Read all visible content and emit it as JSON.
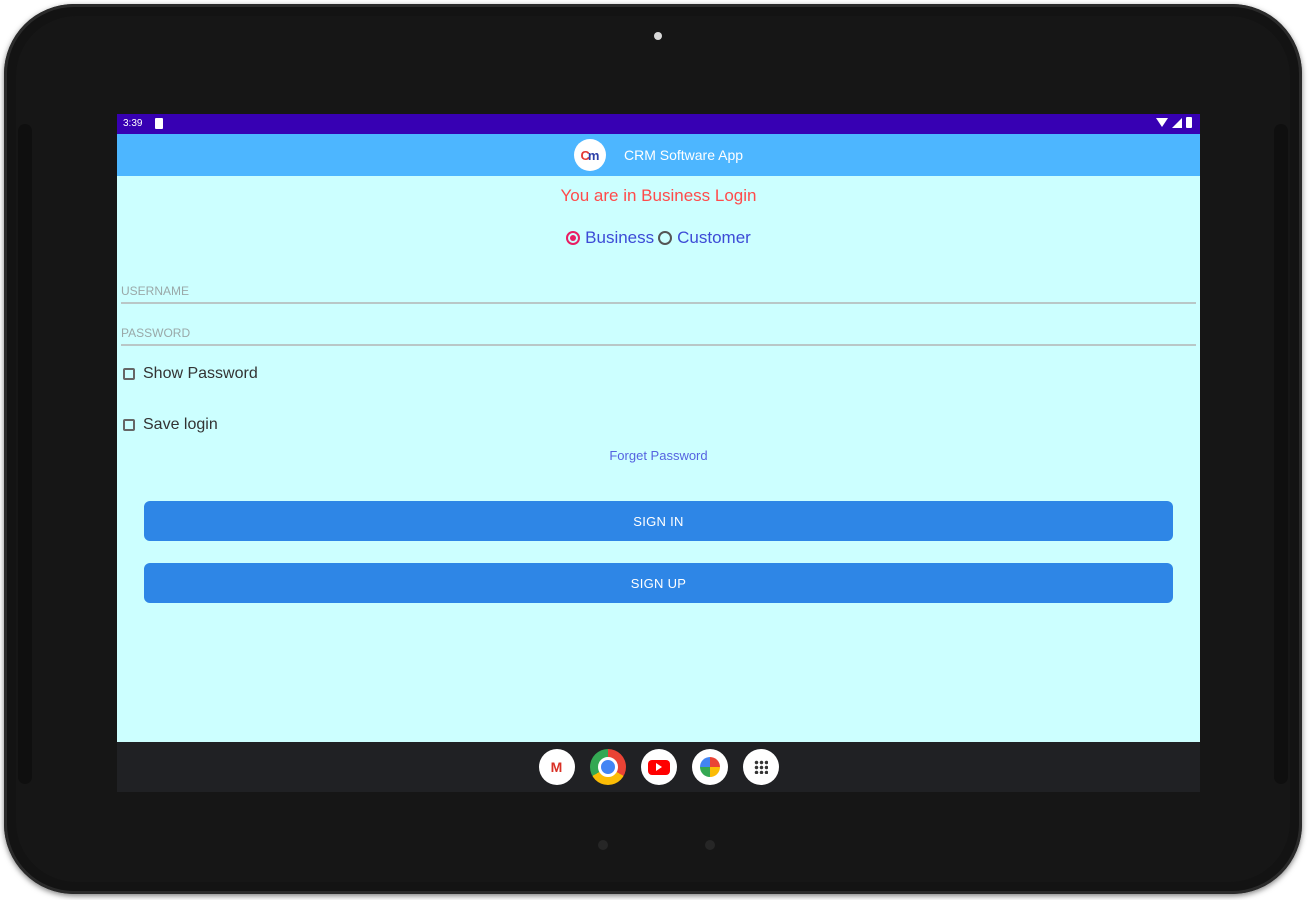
{
  "status_bar": {
    "time": "3:39"
  },
  "app_bar": {
    "logo_text_a": "C",
    "logo_text_b": "m",
    "title": "CRM Software App"
  },
  "login": {
    "mode_message": "You are in Business Login",
    "radio_options": [
      {
        "label": "Business",
        "checked": true
      },
      {
        "label": "Customer",
        "checked": false
      }
    ],
    "username_placeholder": "USERNAME",
    "password_placeholder": "PASSWORD",
    "show_password_label": "Show Password",
    "save_login_label": "Save login",
    "forgot_password_label": "Forget Password",
    "sign_in_label": "SIGN IN",
    "sign_up_label": "SIGN UP"
  },
  "taskbar": {
    "apps": [
      "gmail-icon",
      "chrome-icon",
      "youtube-icon",
      "photos-icon",
      "app-drawer-icon"
    ],
    "gmail_letter": "M"
  },
  "colors": {
    "status_bar": "#3700b3",
    "app_bar": "#4db6ff",
    "background": "#ccffff",
    "mode_message": "#ff4b4b",
    "radio_text": "#3d4bd6",
    "button": "#2e86e6",
    "radio_checked": "#e91e63"
  }
}
